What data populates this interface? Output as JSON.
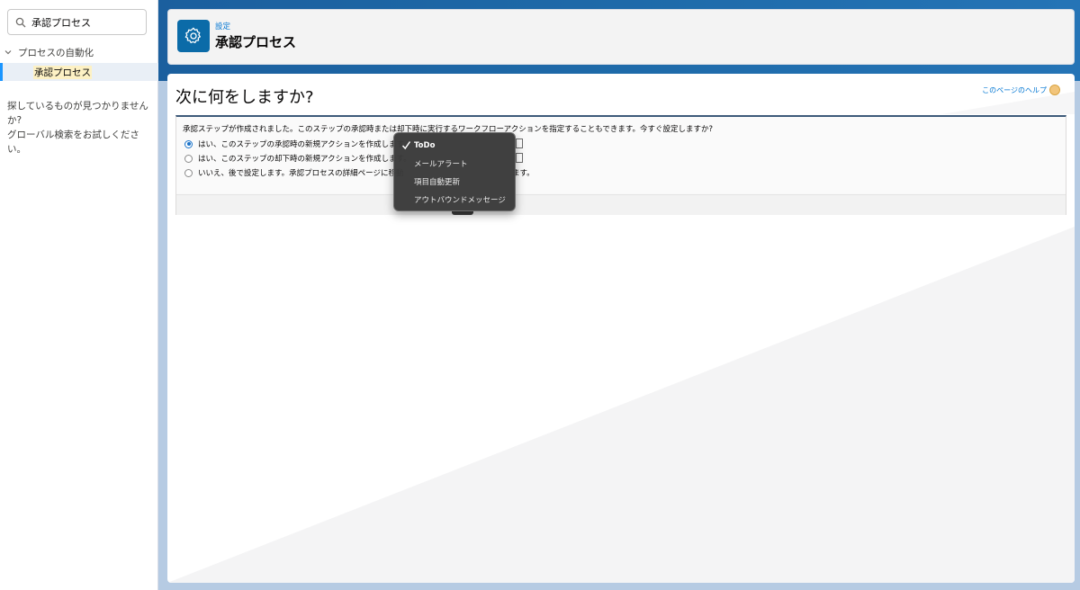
{
  "sidebar": {
    "search_value": "承認プロセス",
    "tree_parent": "プロセスの自動化",
    "tree_child": "承認プロセス",
    "no_find_line1": "探しているものが見つかりませんか?",
    "no_find_line2": "グローバル検索をお試しください。"
  },
  "header": {
    "eyebrow": "設定",
    "title": "承認プロセス",
    "icon": "gear-icon"
  },
  "main": {
    "title": "次に何をしますか?",
    "help_link": "このページのヘルプ",
    "question": "承認ステップが作成されました。このステップの承認時または却下時に実行するワークフローアクションを指定することもできます。今すぐ設定しますか?",
    "options": [
      {
        "label": "はい、このステップの承認時の新規アクションを作成します。",
        "checked": true
      },
      {
        "label": "はい、このステップの却下時の新規アクションを作成します。",
        "checked": false
      },
      {
        "label": "いいえ、後で設定します。承認プロセスの詳細ページに移動",
        "suffix": "ます。",
        "checked": false
      }
    ]
  },
  "menu": {
    "items": [
      {
        "label": "ToDo",
        "selected": true
      },
      {
        "label": "メールアラート",
        "selected": false
      },
      {
        "label": "項目自動更新",
        "selected": false
      },
      {
        "label": "アウトバウンドメッセージ",
        "selected": false
      }
    ]
  },
  "colors": {
    "brand_blue": "#0b6ba8",
    "link_blue": "#0176d3",
    "menu_bg": "#3a3a3a"
  }
}
